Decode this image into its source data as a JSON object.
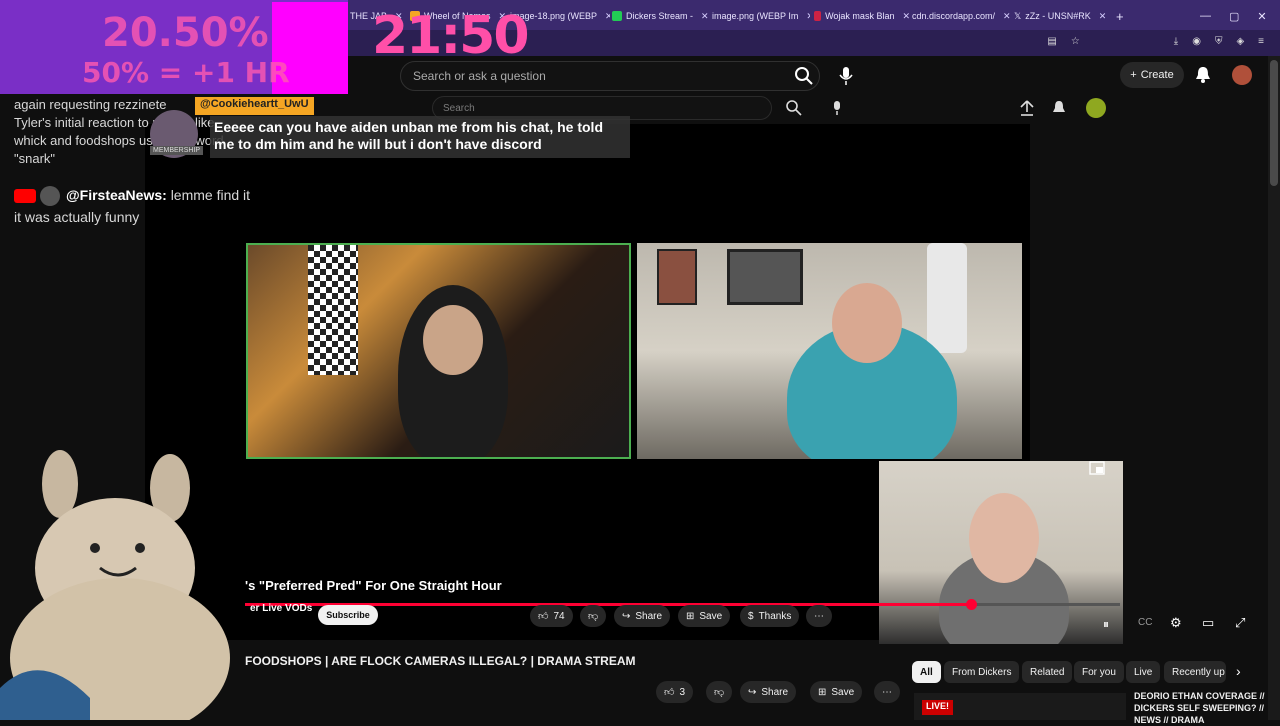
{
  "tabs": [
    {
      "label": "THE JAB",
      "color": "#cc4444"
    },
    {
      "label": "Wheel of Names",
      "color": "#f5a623"
    },
    {
      "label": "image-18.png (WEBP",
      "color": "#888888"
    },
    {
      "label": "Dickers Stream -",
      "color": "#22aa55"
    },
    {
      "label": "image.png (WEBP Im",
      "color": "#888888"
    },
    {
      "label": "Wojak mask Blan",
      "color": "#cc2244"
    },
    {
      "label": "cdn.discordapp.com/",
      "color": "#888888"
    },
    {
      "label": "zZz - UNSN#RK",
      "color": "#222222"
    }
  ],
  "overlay": {
    "percent": "20.50%",
    "bonus": "50% = +1 HR",
    "clock": "21:50"
  },
  "youtube_header": {
    "search_placeholder": "Search or ask a question",
    "create_label": "Create"
  },
  "inner_header": {
    "search_placeholder": "Search"
  },
  "chat": {
    "line1": "again requesting rezzinete",
    "line2": "Tyler's initial reaction to people like",
    "line3": "whick and foodshops using the word",
    "line4": "\"snark\"",
    "firstea_name": "@FirsteaNews:",
    "firstea_msg": "lemme find it",
    "firstea_msg2": "it was actually funny",
    "chip_name": "@Cookieheartt_UwU",
    "membership": "MEMBERSHIP",
    "caption": "Eeeee can you have aiden unban me from his chat, he told me to dm him and he will but i don't have discord"
  },
  "player": {
    "title": "'s \"Preferred Pred\" For One Straight Hour",
    "channel": "er Live VODs",
    "subscribe": "Subscribe",
    "likes": "74",
    "share": "Share",
    "save": "Save",
    "thanks": "Thanks",
    "progress_fraction": 0.83
  },
  "video2": {
    "title": "FOODSHOPS | ARE FLOCK CAMERAS ILLEGAL? | DRAMA STREAM",
    "likes": "3",
    "share": "Share",
    "save": "Save"
  },
  "chips": [
    "All",
    "From Dickers",
    "Related",
    "For you",
    "Live",
    "Recently up"
  ],
  "live_item": {
    "badge": "LIVE!",
    "title": "DEORIO ETHAN COVERAGE // DICKERS SELF SWEEPING? // NEWS // DRAMA"
  }
}
